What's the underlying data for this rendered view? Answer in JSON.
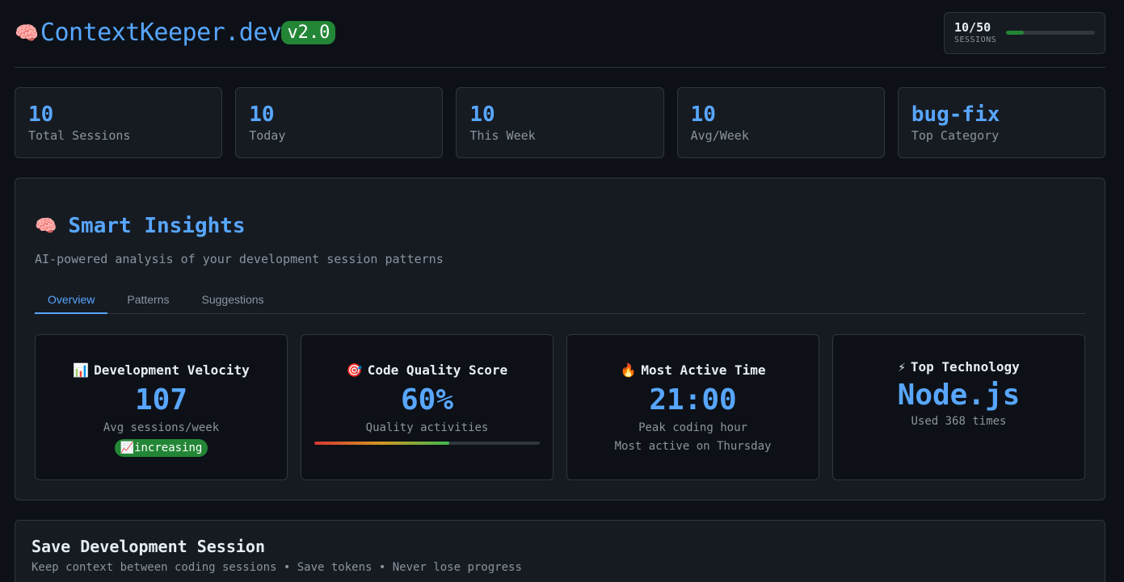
{
  "header": {
    "logo_icon": "🧠",
    "app_name": "ContextKeeper.dev",
    "version": "v2.0",
    "usage": {
      "count": "10/50",
      "unit": "SESSIONS",
      "fill_fraction": 0.2
    }
  },
  "stats": [
    {
      "value": "10",
      "label": "Total Sessions"
    },
    {
      "value": "10",
      "label": "Today"
    },
    {
      "value": "10",
      "label": "This Week"
    },
    {
      "value": "10",
      "label": "Avg/Week"
    },
    {
      "value": "bug-fix",
      "label": "Top Category"
    }
  ],
  "insights": {
    "icon": "🧠",
    "title": "Smart Insights",
    "subtitle": "AI-powered analysis of your development session patterns",
    "tabs": [
      {
        "label": "Overview",
        "active": true
      },
      {
        "label": "Patterns",
        "active": false
      },
      {
        "label": "Suggestions",
        "active": false
      }
    ],
    "cards": {
      "velocity": {
        "icon": "📊",
        "title": "Development Velocity",
        "value": "107",
        "label": "Avg sessions/week",
        "trend": "📈increasing"
      },
      "quality": {
        "icon": "🎯",
        "title": "Code Quality Score",
        "value": "60%",
        "label": "Quality activities",
        "fill_fraction": 0.6
      },
      "active_time": {
        "icon": "🔥",
        "title": "Most Active Time",
        "value": "21:00",
        "label": "Peak coding hour",
        "extra": "Most active on Thursday"
      },
      "technology": {
        "icon": "⚡",
        "title": "Top Technology",
        "value": "Node.js",
        "label": "Used 368 times"
      }
    }
  },
  "save_session": {
    "title": "Save Development Session",
    "subtitle": "Keep context between coding sessions • Save tokens • Never lose progress"
  },
  "colors": {
    "background": "#0d1117",
    "panel": "#161b22",
    "border": "#30363d",
    "accent": "#58a6ff",
    "success": "#238636",
    "muted": "#8b949e"
  }
}
